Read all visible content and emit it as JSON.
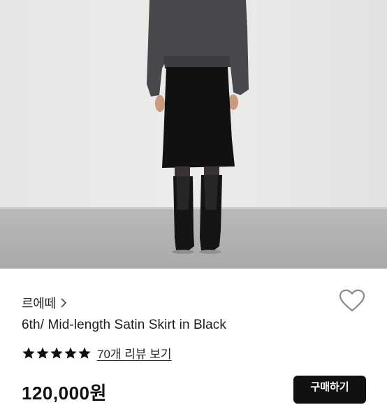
{
  "product": {
    "brand": "르에떼",
    "title": "6th/ Mid-length Satin Skirt in Black",
    "rating_stars": 5,
    "review_link": "70개 리뷰 보기",
    "price": "120,000원",
    "buy_label": "구매하기"
  },
  "icons": {
    "brand_chevron": "chevron-right-icon",
    "wishlist": "heart-outline-icon",
    "rating": "star-icon"
  },
  "colors": {
    "star": "#111111",
    "heart_stroke": "#8a8a8a",
    "button_bg": "#111111"
  }
}
